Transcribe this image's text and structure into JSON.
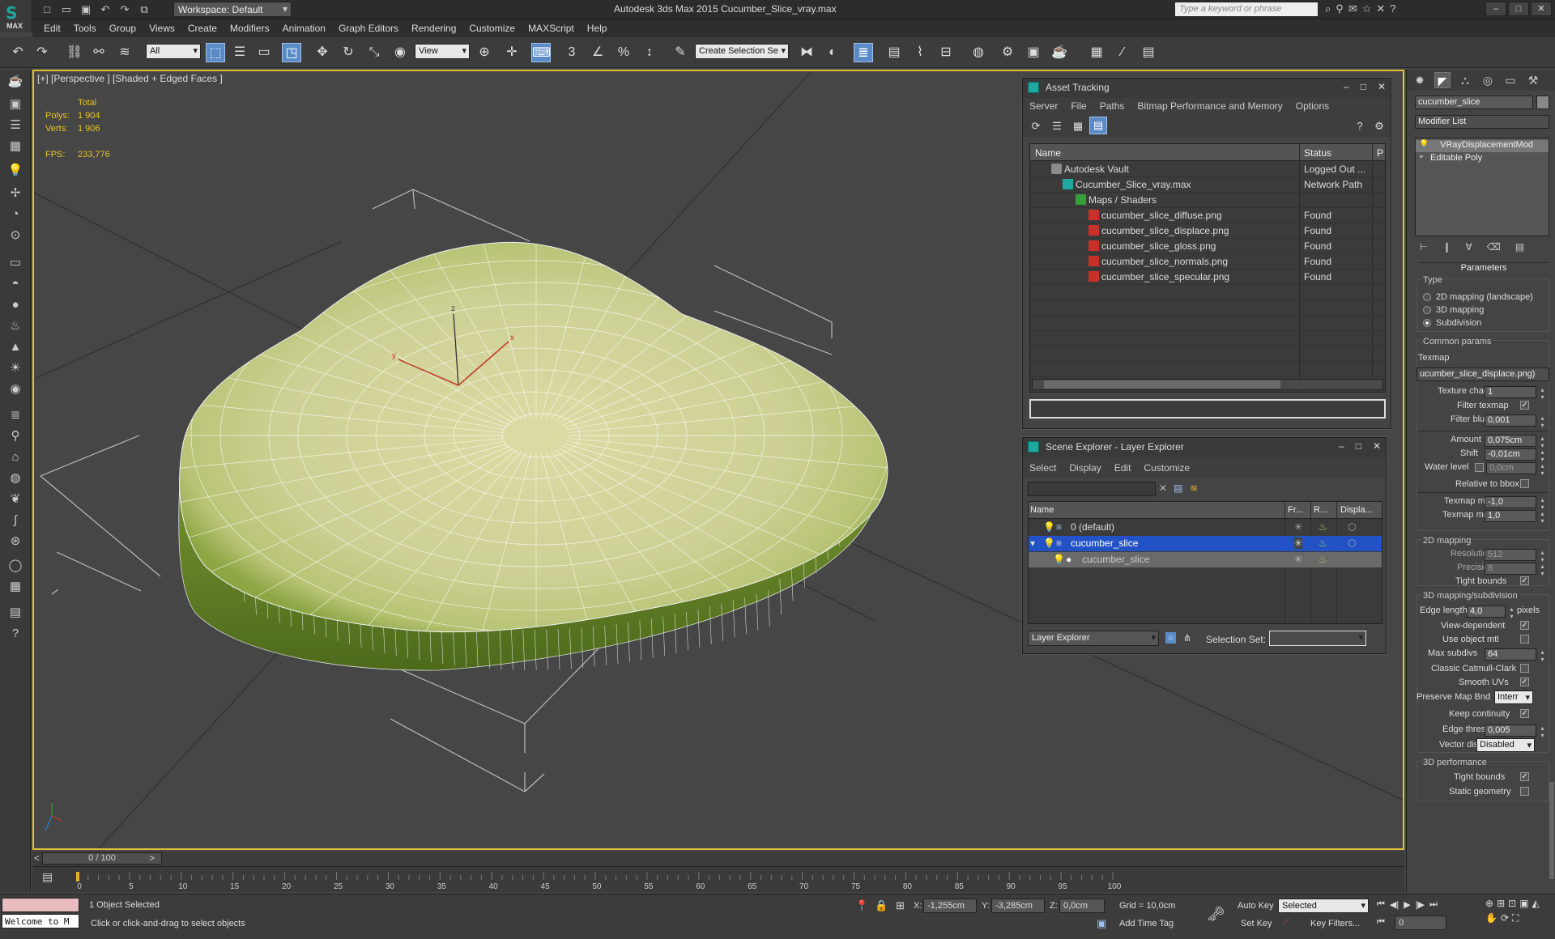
{
  "app": {
    "title": "Autodesk 3ds Max 2015    Cucumber_Slice_vray.max",
    "logo_text": "MAX",
    "workspace": "Workspace: Default",
    "search_placeholder": "Type a keyword or phrase"
  },
  "menu": [
    "Edit",
    "Tools",
    "Group",
    "Views",
    "Create",
    "Modifiers",
    "Animation",
    "Graph Editors",
    "Rendering",
    "Customize",
    "MAXScript",
    "Help"
  ],
  "toolbar": {
    "filter": "All",
    "coord": "View",
    "selection_set": "Create Selection Se",
    "snap_3": "3",
    "snap_angle": "∠",
    "snap_pct": "%",
    "snap_spin": "↕"
  },
  "viewport": {
    "label": "[+] [Perspective ] [Shaded + Edged Faces ]",
    "stats": {
      "header": "Total",
      "polys_label": "Polys:",
      "polys": "1 904",
      "verts_label": "Verts:",
      "verts": "1 906",
      "fps_label": "FPS:",
      "fps": "233,776"
    },
    "axis_x": "x",
    "axis_y": "y",
    "axis_z": "z"
  },
  "asset_tracking": {
    "title": "Asset Tracking",
    "menu": [
      "Server",
      "File",
      "Paths",
      "Bitmap Performance and Memory",
      "Options"
    ],
    "col_name": "Name",
    "col_status": "Status",
    "col_p": "P",
    "rows": [
      {
        "name": "Autodesk Vault",
        "status": "Logged Out ..."
      },
      {
        "name": "Cucumber_Slice_vray.max",
        "status": "Network Path"
      },
      {
        "name": "Maps / Shaders",
        "status": ""
      },
      {
        "name": "cucumber_slice_diffuse.png",
        "status": "Found"
      },
      {
        "name": "cucumber_slice_displace.png",
        "status": "Found"
      },
      {
        "name": "cucumber_slice_gloss.png",
        "status": "Found"
      },
      {
        "name": "cucumber_slice_normals.png",
        "status": "Found"
      },
      {
        "name": "cucumber_slice_specular.png",
        "status": "Found"
      }
    ]
  },
  "scene_explorer": {
    "title": "Scene Explorer - Layer Explorer",
    "menu": [
      "Select",
      "Display",
      "Edit",
      "Customize"
    ],
    "col_name": "Name",
    "col_freeze": "Fr...",
    "col_render": "R...",
    "col_display": "Displa...",
    "rows": [
      {
        "name": "0 (default)"
      },
      {
        "name": "cucumber_slice"
      },
      {
        "name": "cucumber_slice"
      }
    ],
    "footer_label": "Layer Explorer",
    "selection_set_label": "Selection Set:"
  },
  "command_panel": {
    "object_name": "cucumber_slice",
    "modifier_list": "Modifier List",
    "stack": [
      "VRayDisplacementMod",
      "Editable Poly"
    ],
    "parameters": "Parameters",
    "type_label": "Type",
    "type_options": [
      "2D mapping (landscape)",
      "3D mapping",
      "Subdivision"
    ],
    "common_params": "Common params",
    "texmap_label": "Texmap",
    "texmap_value": "ucumber_slice_displace.png)",
    "texture_chan_label": "Texture chan",
    "texture_chan": "1",
    "filter_texmap_label": "Filter texmap",
    "filter_blur_label": "Filter blur",
    "filter_blur": "0,001",
    "amount_label": "Amount",
    "amount": "0,075cm",
    "shift_label": "Shift",
    "shift": "-0,01cm",
    "water_level_label": "Water level",
    "water_level": "0,0cm",
    "relative_bbox_label": "Relative to bbox",
    "texmap_min_label": "Texmap min",
    "texmap_min": "-1,0",
    "texmap_max_label": "Texmap max",
    "texmap_max": "1,0",
    "mapping2d": "2D mapping",
    "resolution_label": "Resolution",
    "resolution": "512",
    "precision_label": "Precision",
    "precision": "8",
    "tight_bounds_label": "Tight bounds",
    "mapping3d": "3D mapping/subdivision",
    "edge_length_label": "Edge length",
    "edge_length": "4,0",
    "pixels_label": "pixels",
    "view_dependent_label": "View-dependent",
    "use_object_mtl_label": "Use object mtl",
    "max_subdivs_label": "Max subdivs",
    "max_subdivs": "64",
    "classic_cc_label": "Classic Catmull-Clark",
    "smooth_uvs_label": "Smooth UVs",
    "preserve_map_label": "Preserve Map Bnd",
    "preserve_map": "Interr",
    "keep_continuity_label": "Keep continuity",
    "edge_thresh_label": "Edge thresh",
    "edge_thresh": "0,005",
    "vector_displ_label": "Vector displ",
    "vector_displ": "Disabled",
    "perf3d": "3D performance",
    "tight_bounds2_label": "Tight bounds",
    "static_geom_label": "Static geometry"
  },
  "timeline": {
    "frame": "0 / 100",
    "ticks": [
      "0",
      "5",
      "10",
      "15",
      "20",
      "25",
      "30",
      "35",
      "40",
      "45",
      "50",
      "55",
      "60",
      "65",
      "70",
      "75",
      "80",
      "85",
      "90",
      "95",
      "100"
    ]
  },
  "status": {
    "welcome": "Welcome to M",
    "selected": "1 Object Selected",
    "prompt": "Click or click-and-drag to select objects",
    "x_label": "X:",
    "x": "-1,255cm",
    "y_label": "Y:",
    "y": "-3,285cm",
    "z_label": "Z:",
    "z": "0,0cm",
    "grid": "Grid = 10,0cm",
    "add_time_tag": "Add Time Tag",
    "auto_key": "Auto Key",
    "set_key": "Set Key",
    "selected_dd": "Selected",
    "key_filters": "Key Filters...",
    "frame_field": "0"
  },
  "colors": {
    "viewport_border": "#e3c23c",
    "stats_text": "#e6c325",
    "selection_blue": "#2352c6",
    "cucumber_flesh": "#d8d9a4",
    "cucumber_skin": "#6d8a2a"
  }
}
